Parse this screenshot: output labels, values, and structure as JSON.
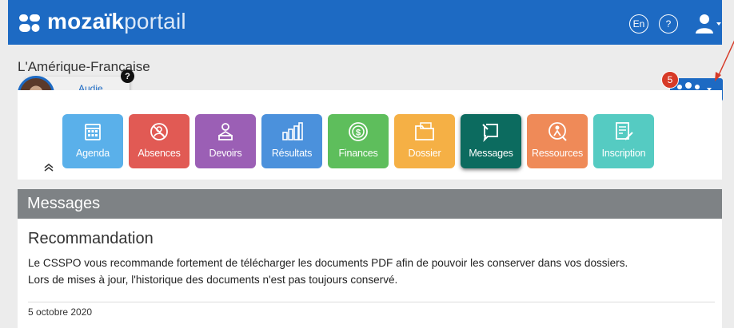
{
  "app": {
    "logo_bold": "mozaïk",
    "logo_light": "portail",
    "lang_button": "En",
    "help_button": "?"
  },
  "school": {
    "name": "L'Amérique-Française",
    "student_name": "Audie",
    "question_badge": "?",
    "notification_count": "5"
  },
  "modules": [
    {
      "label": "Agenda",
      "icon": "calendar-icon",
      "color": "#5ab0ea"
    },
    {
      "label": "Absences",
      "icon": "absence-icon",
      "color": "#e15a54"
    },
    {
      "label": "Devoirs",
      "icon": "homework-icon",
      "color": "#9b5fb5"
    },
    {
      "label": "Résultats",
      "icon": "results-chart-icon",
      "color": "#4b91dc"
    },
    {
      "label": "Finances",
      "icon": "money-icon",
      "color": "#5ebe5c"
    },
    {
      "label": "Dossier",
      "icon": "folder-icon",
      "color": "#f5b045"
    },
    {
      "label": "Messages",
      "icon": "message-icon",
      "color": "#0c6b5f"
    },
    {
      "label": "Ressources",
      "icon": "resources-icon",
      "color": "#ef8a58"
    },
    {
      "label": "Inscription",
      "icon": "inscription-icon",
      "color": "#55cbc2"
    }
  ],
  "messages": {
    "section_title": "Messages",
    "item": {
      "title": "Recommandation",
      "body_line1": "Le CSSPO vous recommande fortement de télécharger les documents PDF afin de pouvoir les conserver dans vos dossiers.",
      "body_line2": "Lors de mises à jour, l'historique des documents n'est pas toujours conservé.",
      "date": "5 octobre 2020"
    }
  },
  "colors": {
    "brand_blue": "#1d6ac3",
    "section_gray": "#7e8285",
    "badge_red": "#d73a27"
  }
}
